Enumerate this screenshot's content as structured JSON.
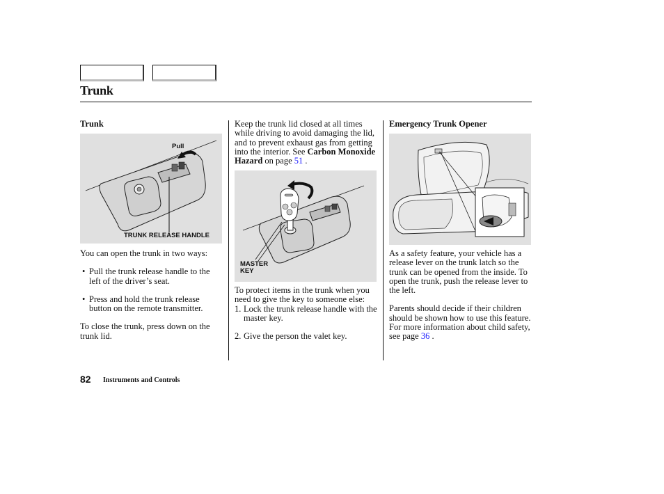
{
  "header": {
    "nav_buttons": [
      "",
      ""
    ],
    "title": "Trunk"
  },
  "left": {
    "heading": "Trunk",
    "figure": {
      "label_pull": "Pull",
      "label_handle": "TRUNK RELEASE HANDLE"
    },
    "intro": "You can open the trunk in two ways:",
    "bullets": [
      "Pull the trunk release handle to the left of the driver’s seat.",
      "Press and hold the trunk release button on the remote transmitter."
    ],
    "closing": "To close the trunk, press down on the trunk lid."
  },
  "middle": {
    "para_before": "Keep the trunk lid closed at all times while driving to avoid damaging the lid, and to prevent exhaust gas from getting into the interior. See ",
    "bold_ref": "Carbon Monoxide Hazard",
    "page_text": " on page ",
    "page_link": "51",
    "period": " .",
    "figure": {
      "label_key_line1": "MASTER",
      "label_key_line2": "KEY"
    },
    "protect_intro": "To protect items in the trunk when you need to give the key to someone else:",
    "steps": [
      {
        "n": "1.",
        "text": "Lock the trunk release handle with the master key."
      },
      {
        "n": "2.",
        "text": "Give the person the valet key."
      }
    ]
  },
  "right": {
    "heading": "Emergency Trunk Opener",
    "para1": "As a safety feature, your vehicle has a release lever on the trunk latch so the trunk can be opened from the inside. To open the trunk, push the release lever to the left.",
    "para2": "Parents should decide if their children should be shown how to use this feature.",
    "para3_before": "For more information about child safety, see page ",
    "page_link": "36",
    "period": " ."
  },
  "footer": {
    "page_number": "82",
    "section": "Instruments and Controls"
  }
}
